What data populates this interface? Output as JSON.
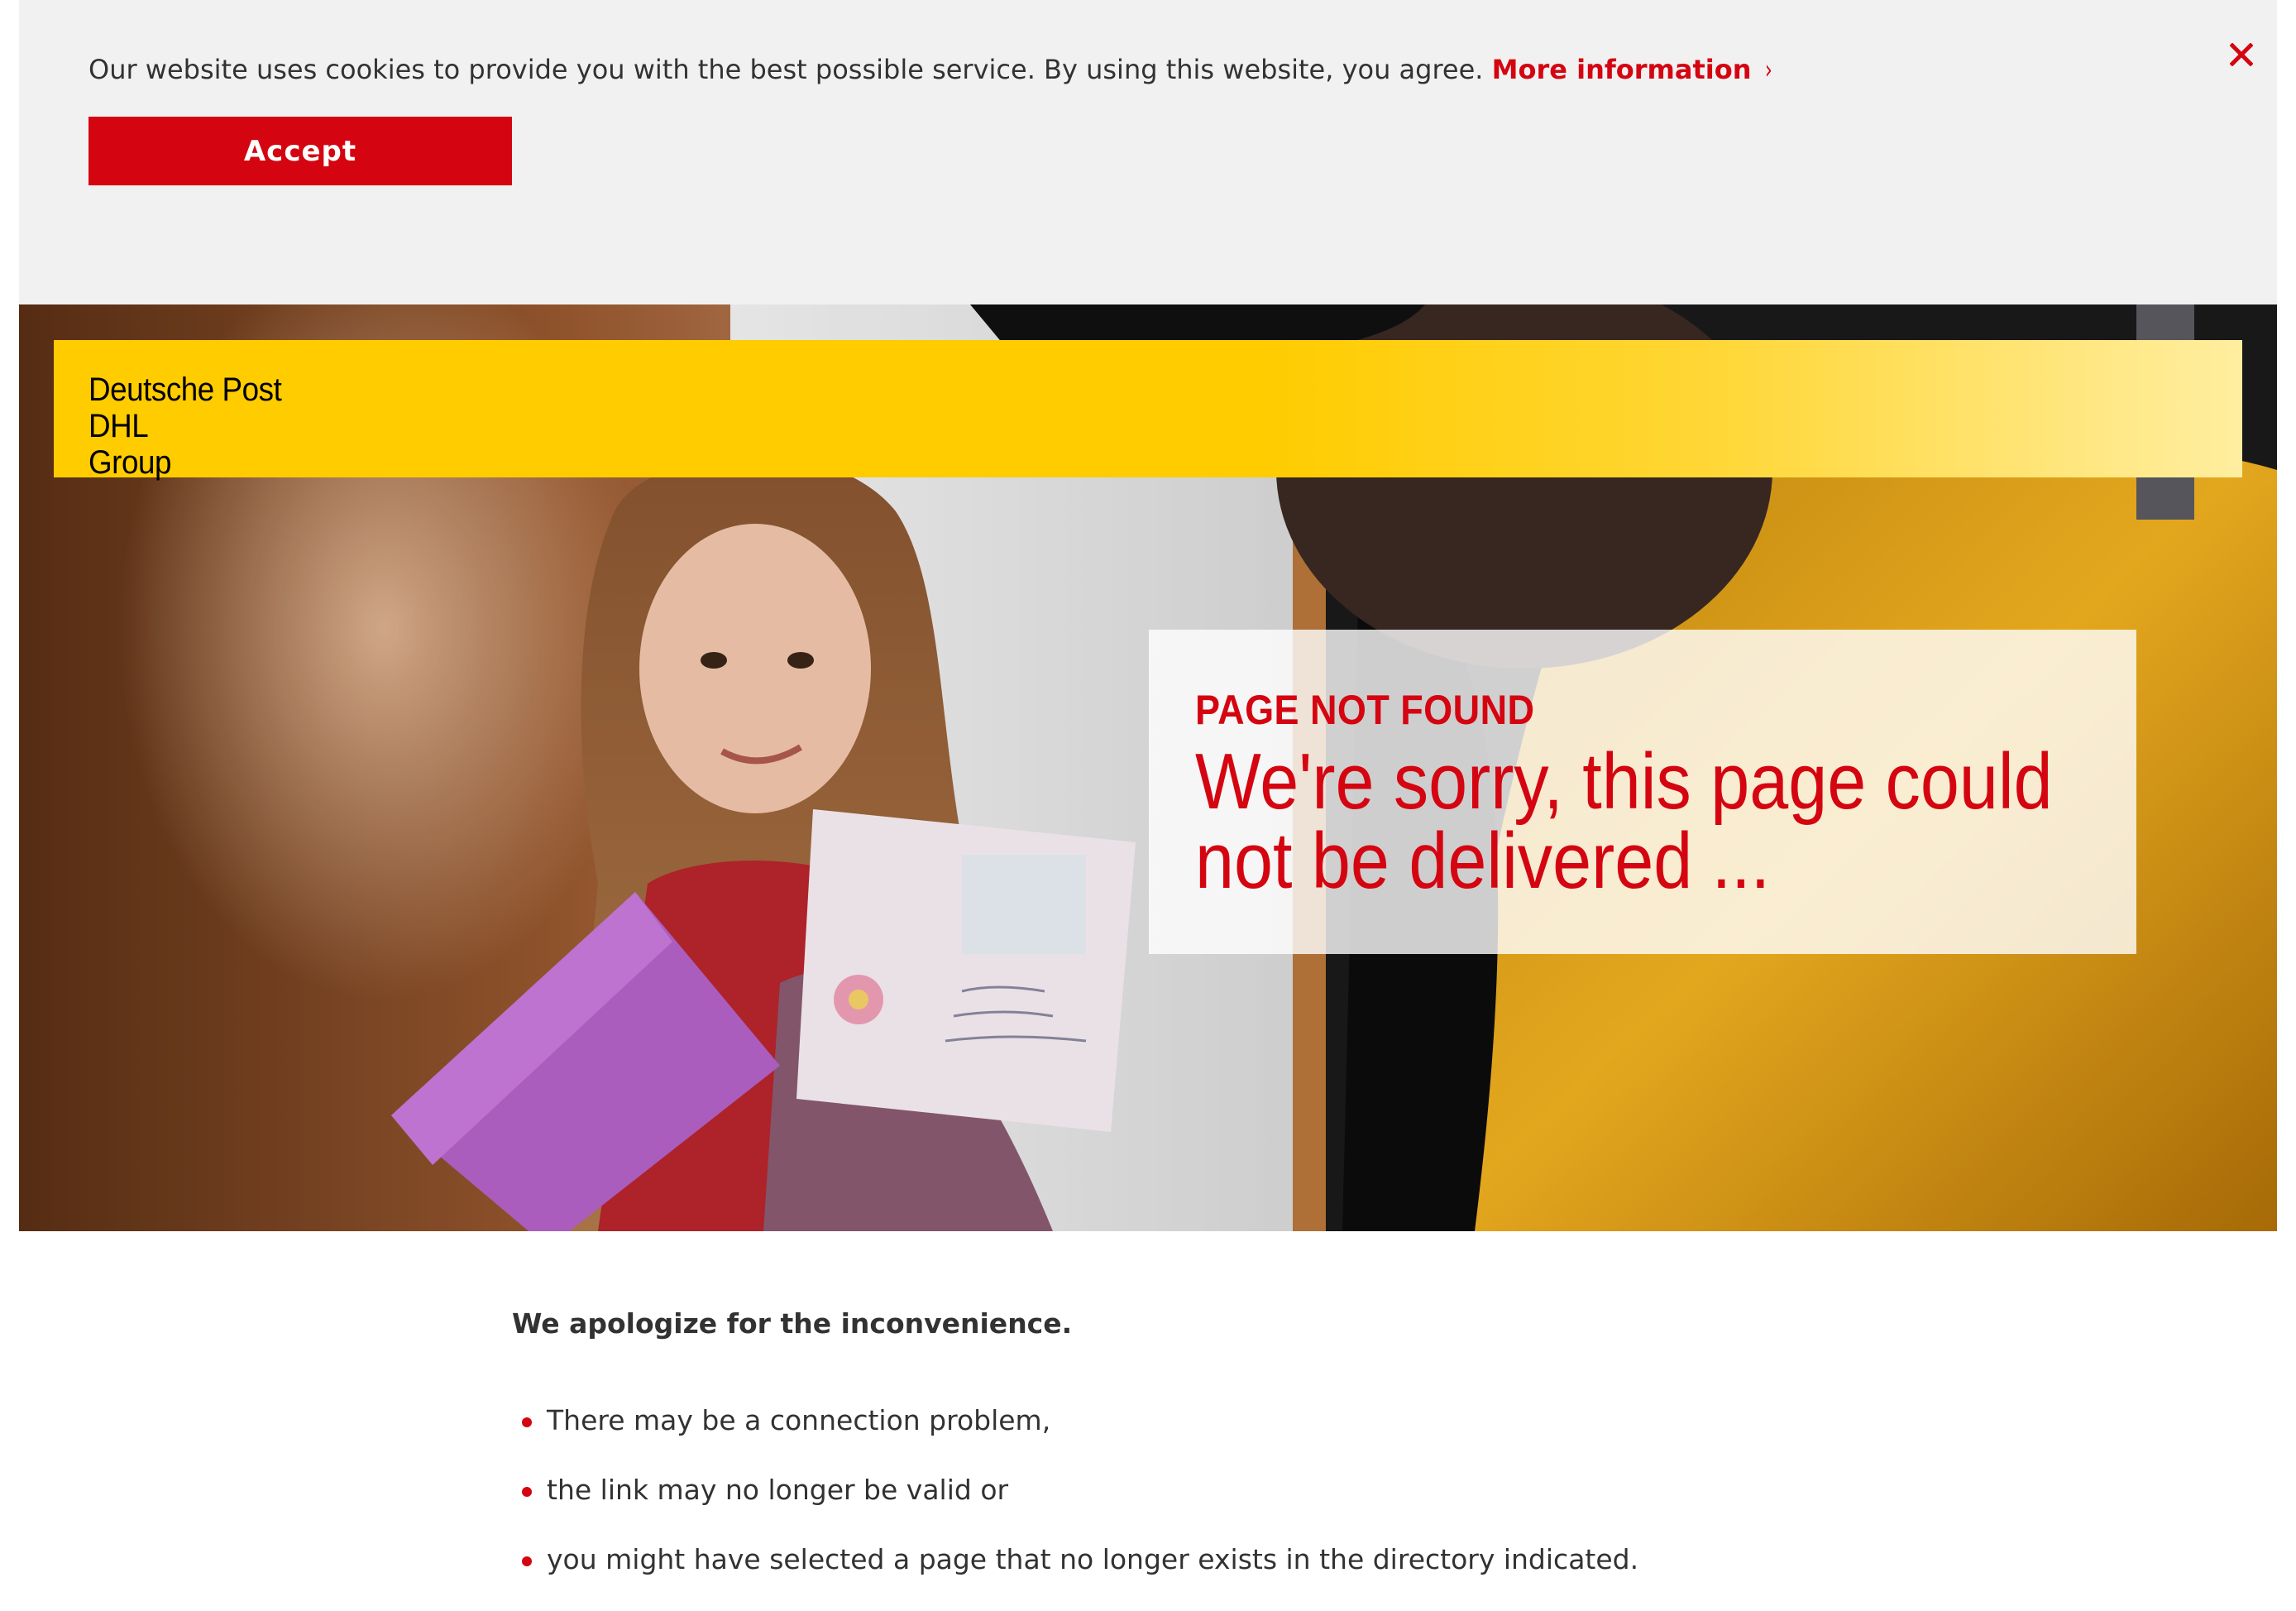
{
  "cookie_banner": {
    "text": "Our website uses cookies to provide you with the best possible service. By using this website, you agree.",
    "more_info_label": "More information",
    "more_info_chevron": "›",
    "accept_label": "Accept",
    "close_icon": "close-icon"
  },
  "header": {
    "logo_line1": "Deutsche Post DHL",
    "logo_line2": "Group"
  },
  "hero": {
    "kicker": "PAGE NOT FOUND",
    "headline": "We're sorry, this page could not be delivered ..."
  },
  "content": {
    "apology": "We apologize for the inconvenience.",
    "reasons": [
      "There may be a connection problem,",
      "the link may no longer be valid or",
      "you might have selected a page that no longer exists in the directory indicated."
    ]
  },
  "colors": {
    "brand_red": "#d40511",
    "brand_yellow": "#ffcc00",
    "banner_bg": "#f1f1f1",
    "text": "#323232"
  }
}
